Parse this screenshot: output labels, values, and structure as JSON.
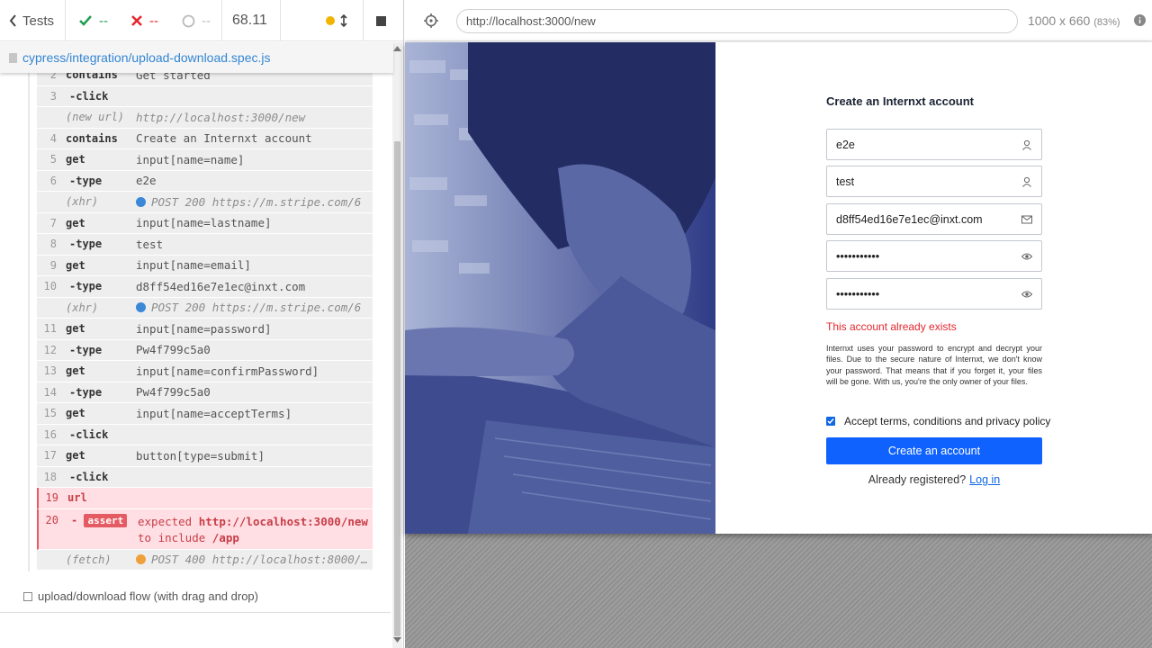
{
  "stats": {
    "back_label": "Tests",
    "passed": "--",
    "failed": "--",
    "pending": "--",
    "duration": "68.11"
  },
  "spec": {
    "path": "cypress/integration/upload-download.spec.js"
  },
  "commands": [
    {
      "num": "2",
      "name": "contains",
      "message": "Get started",
      "child": false
    },
    {
      "num": "3",
      "name": "-click",
      "message": "",
      "child": true
    },
    {
      "event": "(new url)",
      "message": "http://localhost:3000/new"
    },
    {
      "num": "4",
      "name": "contains",
      "message": "Create an Internxt account",
      "child": false
    },
    {
      "num": "5",
      "name": "get",
      "message": "input[name=name]",
      "child": false
    },
    {
      "num": "6",
      "name": "-type",
      "message": "e2e",
      "child": true
    },
    {
      "event": "(xhr)",
      "message": "POST 200 https://m.stripe.com/6",
      "dot": "#3b87d8"
    },
    {
      "num": "7",
      "name": "get",
      "message": "input[name=lastname]",
      "child": false
    },
    {
      "num": "8",
      "name": "-type",
      "message": "test",
      "child": true
    },
    {
      "num": "9",
      "name": "get",
      "message": "input[name=email]",
      "child": false
    },
    {
      "num": "10",
      "name": "-type",
      "message": "d8ff54ed16e7e1ec@inxt.com",
      "child": true
    },
    {
      "event": "(xhr)",
      "message": "POST 200 https://m.stripe.com/6",
      "dot": "#3b87d8"
    },
    {
      "num": "11",
      "name": "get",
      "message": "input[name=password]",
      "child": false
    },
    {
      "num": "12",
      "name": "-type",
      "message": "Pw4f799c5a0",
      "child": true
    },
    {
      "num": "13",
      "name": "get",
      "message": "input[name=confirmPassword]",
      "child": false
    },
    {
      "num": "14",
      "name": "-type",
      "message": "Pw4f799c5a0",
      "child": true
    },
    {
      "num": "15",
      "name": "get",
      "message": "input[name=acceptTerms]",
      "child": false
    },
    {
      "num": "16",
      "name": "-click",
      "message": "",
      "child": true
    },
    {
      "num": "17",
      "name": "get",
      "message": "button[type=submit]",
      "child": false
    },
    {
      "num": "18",
      "name": "-click",
      "message": "",
      "child": true
    }
  ],
  "failed_commands": {
    "url_num": "19",
    "url_name": "url",
    "assert_num": "20",
    "assert_dash": "-",
    "assert_badge": "assert",
    "expected_word": "expected",
    "expected_value": "http://localhost:3000/new",
    "include_word": "to include",
    "include_value": "/app"
  },
  "fetch_row": {
    "event": "(fetch)",
    "message": "POST 400 http://localhost:8000/…",
    "dot": "#f0a03a"
  },
  "next_suite": "upload/download flow (with drag and drop)",
  "browser": {
    "url": "http://localhost:3000/new",
    "viewport": "1000 x 660",
    "scale": "(83%)"
  },
  "signup": {
    "title": "Create an Internxt account",
    "name_value": "e2e",
    "lastname_value": "test",
    "email_value": "d8ff54ed16e7e1ec@inxt.com",
    "password_value": "•••••••••••",
    "confirm_value": "•••••••••••",
    "error": "This account already exists",
    "info": "Internxt uses your password to encrypt and decrypt your files. Due to the secure nature of Internxt, we don't know your password. That means that if you forget it, your files will be gone. With us, you're the only owner of your files.",
    "terms_label": "Accept terms, conditions and privacy policy",
    "submit_label": "Create an account",
    "already_label": "Already registered?",
    "login_label": "Log in"
  },
  "colors": {
    "passed": "#1e9f52",
    "failed": "#e3262d",
    "accent": "#0f62fe",
    "hero_overlay": "#3a4a92"
  }
}
